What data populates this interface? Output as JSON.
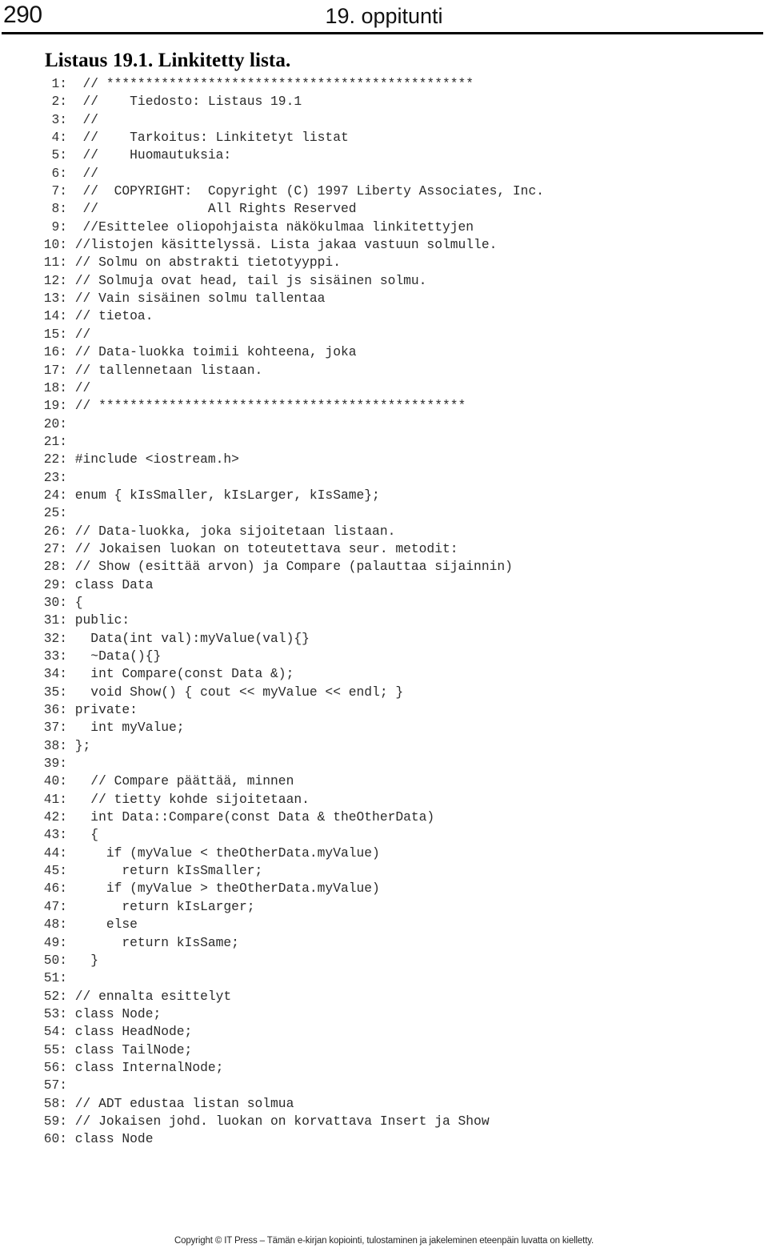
{
  "header": {
    "page_number": "290",
    "chapter_title": "19. oppitunti"
  },
  "listing": {
    "title": "Listaus 19.1. Linkitetty lista.",
    "lines": [
      {
        "no": "1:",
        "text": "  // ***********************************************"
      },
      {
        "no": "2:",
        "text": "  //    Tiedosto: Listaus 19.1"
      },
      {
        "no": "3:",
        "text": "  //"
      },
      {
        "no": "4:",
        "text": "  //    Tarkoitus: Linkitetyt listat"
      },
      {
        "no": "5:",
        "text": "  //    Huomautuksia:"
      },
      {
        "no": "6:",
        "text": "  //"
      },
      {
        "no": "7:",
        "text": "  //  COPYRIGHT:  Copyright (C) 1997 Liberty Associates, Inc."
      },
      {
        "no": "8:",
        "text": "  //              All Rights Reserved"
      },
      {
        "no": "9:",
        "text": "  //Esittelee oliopohjaista näkökulmaa linkitettyjen"
      },
      {
        "no": "10:",
        "text": " //listojen käsittelyssä. Lista jakaa vastuun solmulle."
      },
      {
        "no": "11:",
        "text": " // Solmu on abstrakti tietotyyppi."
      },
      {
        "no": "12:",
        "text": " // Solmuja ovat head, tail js sisäinen solmu."
      },
      {
        "no": "13:",
        "text": " // Vain sisäinen solmu tallentaa"
      },
      {
        "no": "14:",
        "text": " // tietoa."
      },
      {
        "no": "15:",
        "text": " //"
      },
      {
        "no": "16:",
        "text": " // Data-luokka toimii kohteena, joka"
      },
      {
        "no": "17:",
        "text": " // tallennetaan listaan."
      },
      {
        "no": "18:",
        "text": " //"
      },
      {
        "no": "19:",
        "text": " // ***********************************************"
      },
      {
        "no": "20:",
        "text": ""
      },
      {
        "no": "21:",
        "text": ""
      },
      {
        "no": "22:",
        "text": " #include <iostream.h>"
      },
      {
        "no": "23:",
        "text": ""
      },
      {
        "no": "24:",
        "text": " enum { kIsSmaller, kIsLarger, kIsSame};"
      },
      {
        "no": "25:",
        "text": ""
      },
      {
        "no": "26:",
        "text": " // Data-luokka, joka sijoitetaan listaan."
      },
      {
        "no": "27:",
        "text": " // Jokaisen luokan on toteutettava seur. metodit:"
      },
      {
        "no": "28:",
        "text": " // Show (esittää arvon) ja Compare (palauttaa sijainnin)"
      },
      {
        "no": "29:",
        "text": " class Data"
      },
      {
        "no": "30:",
        "text": " {"
      },
      {
        "no": "31:",
        "text": " public:"
      },
      {
        "no": "32:",
        "text": "   Data(int val):myValue(val){}"
      },
      {
        "no": "33:",
        "text": "   ~Data(){}"
      },
      {
        "no": "34:",
        "text": "   int Compare(const Data &);"
      },
      {
        "no": "35:",
        "text": "   void Show() { cout << myValue << endl; }"
      },
      {
        "no": "36:",
        "text": " private:"
      },
      {
        "no": "37:",
        "text": "   int myValue;"
      },
      {
        "no": "38:",
        "text": " };"
      },
      {
        "no": "39:",
        "text": ""
      },
      {
        "no": "40:",
        "text": "   // Compare päättää, minnen"
      },
      {
        "no": "41:",
        "text": "   // tietty kohde sijoitetaan."
      },
      {
        "no": "42:",
        "text": "   int Data::Compare(const Data & theOtherData)"
      },
      {
        "no": "43:",
        "text": "   {"
      },
      {
        "no": "44:",
        "text": "     if (myValue < theOtherData.myValue)"
      },
      {
        "no": "45:",
        "text": "       return kIsSmaller;"
      },
      {
        "no": "46:",
        "text": "     if (myValue > theOtherData.myValue)"
      },
      {
        "no": "47:",
        "text": "       return kIsLarger;"
      },
      {
        "no": "48:",
        "text": "     else"
      },
      {
        "no": "49:",
        "text": "       return kIsSame;"
      },
      {
        "no": "50:",
        "text": "   }"
      },
      {
        "no": "51:",
        "text": ""
      },
      {
        "no": "52:",
        "text": " // ennalta esittelyt"
      },
      {
        "no": "53:",
        "text": " class Node;"
      },
      {
        "no": "54:",
        "text": " class HeadNode;"
      },
      {
        "no": "55:",
        "text": " class TailNode;"
      },
      {
        "no": "56:",
        "text": " class InternalNode;"
      },
      {
        "no": "57:",
        "text": ""
      },
      {
        "no": "58:",
        "text": " // ADT edustaa listan solmua"
      },
      {
        "no": "59:",
        "text": " // Jokaisen johd. luokan on korvattava Insert ja Show"
      },
      {
        "no": "60:",
        "text": " class Node"
      }
    ]
  },
  "footer": {
    "copyright": "Copyright © IT Press – Tämän e-kirjan kopiointi, tulostaminen ja jakeleminen eteenpäin luvatta on kielletty."
  }
}
